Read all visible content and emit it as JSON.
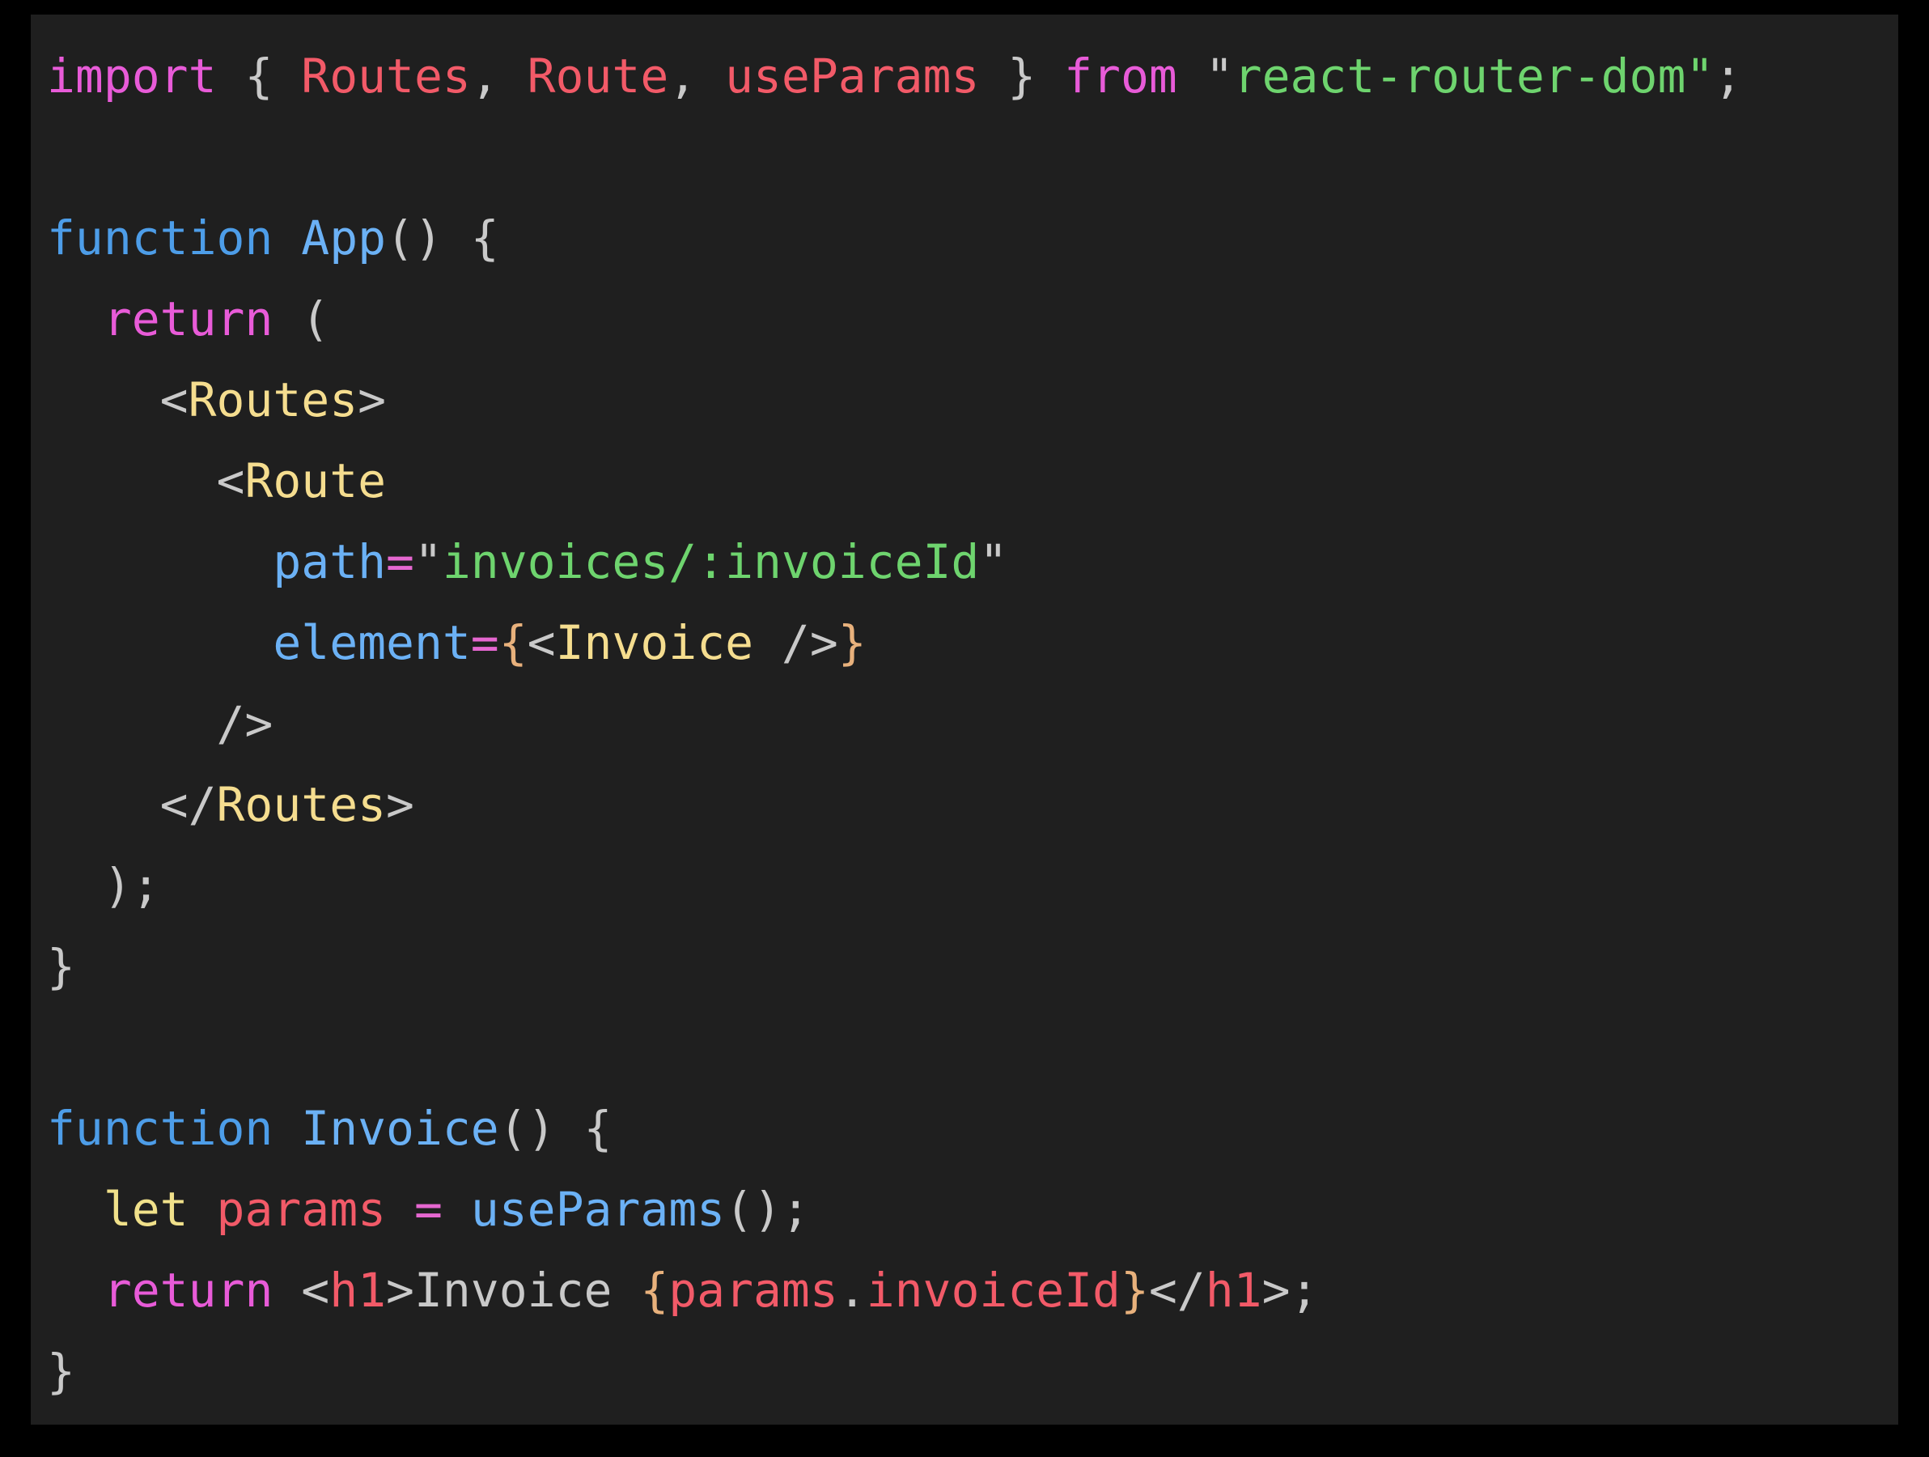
{
  "panel": {
    "background": "#1f1f1f",
    "outer_background": "#000000"
  },
  "theme": {
    "keyword": "#e85bd8",
    "punctuation": "#c9c9c9",
    "identifier": "#f25a68",
    "string": "#6ed46e",
    "function_keyword": "#4d9de8",
    "function_name": "#6bb1f5",
    "jsx_tag": "#f5dd8f",
    "jsx_attribute": "#6bb1f5",
    "equals": "#e567d0",
    "jsx_brace": "#e8b17c",
    "let_keyword": "#f0e08a",
    "html_tag": "#f25a68",
    "jsx_text": "#c9c9c9"
  },
  "code": {
    "language": "jsx",
    "full_text": "import { Routes, Route, useParams } from \"react-router-dom\";\n\nfunction App() {\n  return (\n    <Routes>\n      <Route\n        path=\"invoices/:invoiceId\"\n        element={<Invoice />}\n      />\n    </Routes>\n  );\n}\n\nfunction Invoice() {\n  let params = useParams();\n  return <h1>Invoice {params.invoiceId}</h1>;\n}",
    "lines": [
      {
        "n": 1,
        "text": "import { Routes, Route, useParams } from \"react-router-dom\";",
        "tokens": [
          {
            "t": "import",
            "c": "keyword"
          },
          {
            "t": " ",
            "c": "plain"
          },
          {
            "t": "{",
            "c": "punctuation"
          },
          {
            "t": " ",
            "c": "plain"
          },
          {
            "t": "Routes",
            "c": "identifier"
          },
          {
            "t": ", ",
            "c": "punctuation"
          },
          {
            "t": "Route",
            "c": "identifier"
          },
          {
            "t": ", ",
            "c": "punctuation"
          },
          {
            "t": "useParams",
            "c": "identifier"
          },
          {
            "t": " ",
            "c": "plain"
          },
          {
            "t": "}",
            "c": "punctuation"
          },
          {
            "t": " ",
            "c": "plain"
          },
          {
            "t": "from",
            "c": "keyword"
          },
          {
            "t": " ",
            "c": "plain"
          },
          {
            "t": "\"",
            "c": "punctuation"
          },
          {
            "t": "react-router-dom",
            "c": "string"
          },
          {
            "t": "\"",
            "c": "string"
          },
          {
            "t": ";",
            "c": "punctuation"
          }
        ]
      },
      {
        "n": 2,
        "text": "",
        "tokens": []
      },
      {
        "n": 3,
        "text": "function App() {",
        "tokens": [
          {
            "t": "function",
            "c": "function_keyword"
          },
          {
            "t": " ",
            "c": "plain"
          },
          {
            "t": "App",
            "c": "function_name"
          },
          {
            "t": "() {",
            "c": "punctuation"
          }
        ]
      },
      {
        "n": 4,
        "text": "  return (",
        "tokens": [
          {
            "t": "  ",
            "c": "plain"
          },
          {
            "t": "return",
            "c": "keyword"
          },
          {
            "t": " (",
            "c": "punctuation"
          }
        ]
      },
      {
        "n": 5,
        "text": "    <Routes>",
        "tokens": [
          {
            "t": "    <",
            "c": "punctuation"
          },
          {
            "t": "Routes",
            "c": "jsx_tag"
          },
          {
            "t": ">",
            "c": "punctuation"
          }
        ]
      },
      {
        "n": 6,
        "text": "      <Route",
        "tokens": [
          {
            "t": "      <",
            "c": "punctuation"
          },
          {
            "t": "Route",
            "c": "jsx_tag"
          }
        ]
      },
      {
        "n": 7,
        "text": "        path=\"invoices/:invoiceId\"",
        "tokens": [
          {
            "t": "        ",
            "c": "plain"
          },
          {
            "t": "path",
            "c": "jsx_attribute"
          },
          {
            "t": "=",
            "c": "equals"
          },
          {
            "t": "\"",
            "c": "punctuation"
          },
          {
            "t": "invoices/:invoiceId",
            "c": "string"
          },
          {
            "t": "\"",
            "c": "punctuation"
          }
        ]
      },
      {
        "n": 8,
        "text": "        element={<Invoice />}",
        "tokens": [
          {
            "t": "        ",
            "c": "plain"
          },
          {
            "t": "element",
            "c": "jsx_attribute"
          },
          {
            "t": "=",
            "c": "equals"
          },
          {
            "t": "{",
            "c": "jsx_brace"
          },
          {
            "t": "<",
            "c": "punctuation"
          },
          {
            "t": "Invoice",
            "c": "jsx_tag"
          },
          {
            "t": " />",
            "c": "punctuation"
          },
          {
            "t": "}",
            "c": "jsx_brace"
          }
        ]
      },
      {
        "n": 9,
        "text": "      />",
        "tokens": [
          {
            "t": "      />",
            "c": "punctuation"
          }
        ]
      },
      {
        "n": 10,
        "text": "    </Routes>",
        "tokens": [
          {
            "t": "    </",
            "c": "punctuation"
          },
          {
            "t": "Routes",
            "c": "jsx_tag"
          },
          {
            "t": ">",
            "c": "punctuation"
          }
        ]
      },
      {
        "n": 11,
        "text": "  );",
        "tokens": [
          {
            "t": "  );",
            "c": "punctuation"
          }
        ]
      },
      {
        "n": 12,
        "text": "}",
        "tokens": [
          {
            "t": "}",
            "c": "punctuation"
          }
        ]
      },
      {
        "n": 13,
        "text": "",
        "tokens": []
      },
      {
        "n": 14,
        "text": "function Invoice() {",
        "tokens": [
          {
            "t": "function",
            "c": "function_keyword"
          },
          {
            "t": " ",
            "c": "plain"
          },
          {
            "t": "Invoice",
            "c": "function_name"
          },
          {
            "t": "() {",
            "c": "punctuation"
          }
        ]
      },
      {
        "n": 15,
        "text": "  let params = useParams();",
        "tokens": [
          {
            "t": "  ",
            "c": "plain"
          },
          {
            "t": "let",
            "c": "let_keyword"
          },
          {
            "t": " ",
            "c": "plain"
          },
          {
            "t": "params",
            "c": "identifier"
          },
          {
            "t": " ",
            "c": "plain"
          },
          {
            "t": "=",
            "c": "equals"
          },
          {
            "t": " ",
            "c": "plain"
          },
          {
            "t": "useParams",
            "c": "function_name"
          },
          {
            "t": "();",
            "c": "punctuation"
          }
        ]
      },
      {
        "n": 16,
        "text": "  return <h1>Invoice {params.invoiceId}</h1>;",
        "tokens": [
          {
            "t": "  ",
            "c": "plain"
          },
          {
            "t": "return",
            "c": "keyword"
          },
          {
            "t": " <",
            "c": "punctuation"
          },
          {
            "t": "h1",
            "c": "html_tag"
          },
          {
            "t": ">",
            "c": "punctuation"
          },
          {
            "t": "Invoice ",
            "c": "jsx_text"
          },
          {
            "t": "{",
            "c": "jsx_brace"
          },
          {
            "t": "params",
            "c": "identifier"
          },
          {
            "t": ".",
            "c": "punctuation"
          },
          {
            "t": "invoiceId",
            "c": "identifier"
          },
          {
            "t": "}",
            "c": "jsx_brace"
          },
          {
            "t": "</",
            "c": "punctuation"
          },
          {
            "t": "h1",
            "c": "html_tag"
          },
          {
            "t": ">;",
            "c": "punctuation"
          }
        ]
      },
      {
        "n": 17,
        "text": "}",
        "tokens": [
          {
            "t": "}",
            "c": "punctuation"
          }
        ]
      }
    ]
  }
}
